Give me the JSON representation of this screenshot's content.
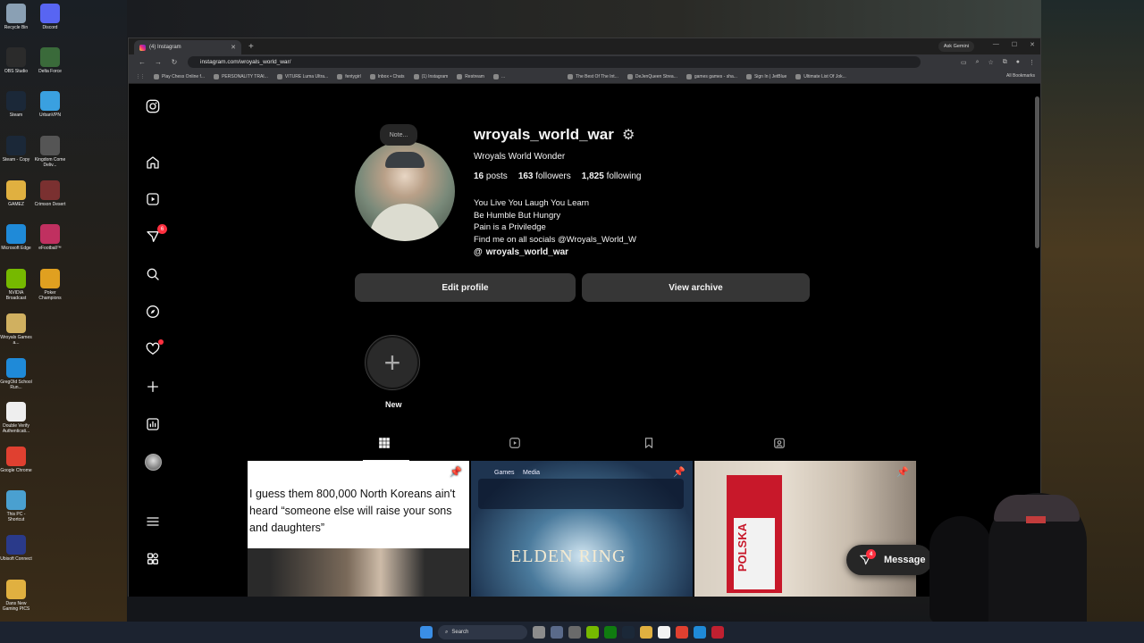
{
  "desktop": {
    "icons": [
      {
        "label": "Recycle Bin",
        "color": "#8aa0b4"
      },
      {
        "label": "Discord",
        "color": "#5865f2"
      },
      {
        "label": "OBS Studio",
        "color": "#2b2b2b"
      },
      {
        "label": "Delta Force",
        "color": "#3a6a3a"
      },
      {
        "label": "Steam",
        "color": "#1b2838"
      },
      {
        "label": "UrbanVPN",
        "color": "#3aa0e0"
      },
      {
        "label": "Steam - Copy",
        "color": "#1b2838"
      },
      {
        "label": "Kingdom Come Deliv...",
        "color": "#555555"
      },
      {
        "label": "GAMEZ",
        "color": "#e0b040"
      },
      {
        "label": "Crimson Desert",
        "color": "#7a3030"
      },
      {
        "label": "Microsoft Edge",
        "color": "#1f8ad8"
      },
      {
        "label": "eFootball™",
        "color": "#c03060"
      },
      {
        "label": "NVIDIA Broadcast",
        "color": "#76b900"
      },
      {
        "label": "Poker Champions",
        "color": "#e0a020"
      },
      {
        "label": "Wroyals Games a...",
        "color": "#d0b060"
      },
      {
        "label": "GregOld School Run...",
        "color": "#1f8ad8"
      },
      {
        "label": "Double Verify Authenticati...",
        "color": "#eeeeee"
      },
      {
        "label": "Google Chrome",
        "color": "#e04030"
      },
      {
        "label": "This PC - Shortcut",
        "color": "#4aa0d0"
      },
      {
        "label": "Ubisoft Connect",
        "color": "#2a3a8a"
      },
      {
        "label": "Dans New Gaming PICS",
        "color": "#e0b040"
      }
    ]
  },
  "browser": {
    "tab_title": "(4) Instagram",
    "new_tab": "+",
    "ask_gemini": "Ask Gemini",
    "url": "instagram.com/wroyals_world_war/",
    "bookmarks": [
      "Play Chess Online f...",
      "PERSONALITY TRAI...",
      "VITURE Luma Ultra...",
      "fentygirl",
      "Inbox • Chats",
      "(1) Instagram",
      "Restream",
      "...",
      "The Best Of The Int...",
      "DeJenQueen Strea...",
      "games games - sha...",
      "Sign In | JetBlue",
      "Ultimate List Of Jok..."
    ],
    "all_bookmarks": "All Bookmarks"
  },
  "sidebar": {
    "messages_badge": "6"
  },
  "profile": {
    "note": "Note...",
    "username": "wroyals_world_war",
    "full_name": "Wroyals World Wonder",
    "posts_count": "16",
    "posts_label": "posts",
    "followers_count": "163",
    "followers_label": "followers",
    "following_count": "1,825",
    "following_label": "following",
    "bio": [
      "You Live You Laugh You Learn",
      "Be Humble But Hungry",
      "Pain is a Priviledge",
      "Find me on all socials @Wroyals_World_W"
    ],
    "threads_handle": "wroyals_world_war",
    "edit_profile": "Edit profile",
    "view_archive": "View archive",
    "new_highlight": "New"
  },
  "posts": {
    "post1_caption": "I guess them 800,000 North Koreans ain't heard “someone else will raise your sons and daughters”",
    "post2_tab_games": "Games",
    "post2_tab_media": "Media",
    "post2_title": "ELDEN RING",
    "post3_flag": "POLSKA"
  },
  "message_pill": {
    "label": "Message",
    "badge": "4"
  },
  "taskbar": {
    "search": "Search"
  },
  "colors": {
    "accent_badge": "#ff3040",
    "button_bg": "#363636",
    "page_bg": "#000000"
  }
}
